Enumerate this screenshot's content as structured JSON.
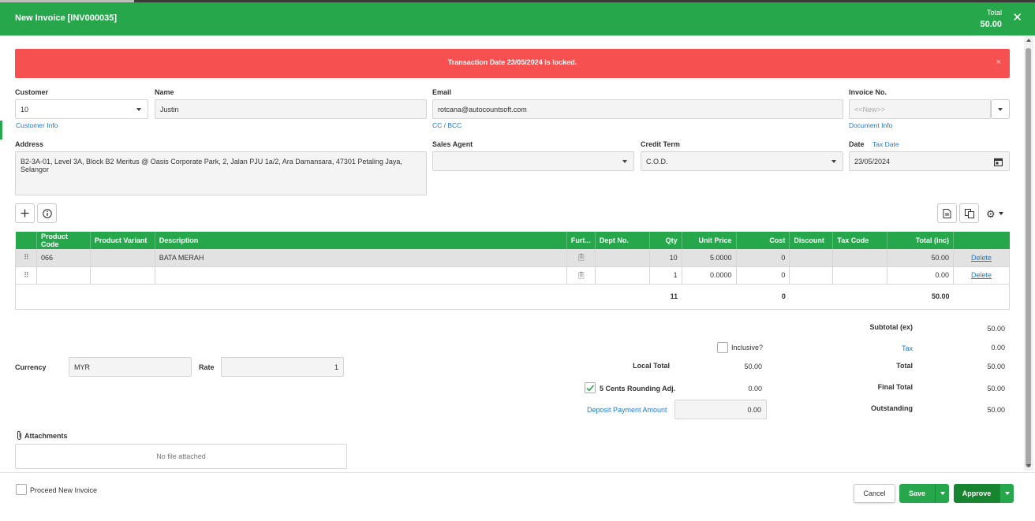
{
  "header": {
    "title": "New Invoice [INV000035]",
    "total_label": "Total",
    "total_value": "50.00",
    "close_icon": "close-icon"
  },
  "alert": {
    "message": "Transaction Date 23/05/2024 is locked.",
    "close": "×"
  },
  "customer": {
    "label": "Customer",
    "value": "10",
    "link": "Customer Info"
  },
  "name": {
    "label": "Name",
    "value": "Justin"
  },
  "email": {
    "label": "Email",
    "value": "rotcana@autocountsoft.com",
    "link": "CC / BCC"
  },
  "invoice_no": {
    "label": "Invoice No.",
    "placeholder": "<<New>>",
    "link": "Document Info"
  },
  "address": {
    "label": "Address",
    "value": "B2-3A-01, Level 3A, Block B2 Meritus @ Oasis Corporate Park, 2, Jalan PJU 1a/2, Ara Damansara, 47301 Petaling Jaya, Selangor"
  },
  "sales_agent": {
    "label": "Sales Agent",
    "value": ""
  },
  "credit_term": {
    "label": "Credit Term",
    "value": "C.O.D."
  },
  "date": {
    "label": "Date",
    "tax_date_link": "Tax Date",
    "value": "23/05/2024"
  },
  "grid": {
    "columns": [
      "Product Code",
      "Product Variant",
      "Description",
      "Furt...",
      "Dept No.",
      "Qty",
      "Unit Price",
      "Cost",
      "Discount",
      "Tax Code",
      "Total (inc)"
    ],
    "rows": [
      {
        "code": "066",
        "variant": "",
        "description": "BATA MERAH",
        "dept": "",
        "qty": "10",
        "unit_price": "5.0000",
        "cost": "0",
        "discount": "",
        "tax_code": "",
        "total": "50.00",
        "action": "Delete"
      },
      {
        "code": "",
        "variant": "",
        "description": "",
        "dept": "",
        "qty": "1",
        "unit_price": "0.0000",
        "cost": "0",
        "discount": "",
        "tax_code": "",
        "total": "0.00",
        "action": "Delete"
      }
    ],
    "totals": {
      "qty": "11",
      "cost": "0",
      "total": "50.00"
    }
  },
  "currency": {
    "label": "Currency",
    "value": "MYR",
    "rate_label": "Rate",
    "rate_value": "1"
  },
  "middle": {
    "inclusive_label": "Inclusive?",
    "local_total_label": "Local Total",
    "local_total_value": "50.00",
    "rounding_label": "5 Cents Rounding Adj.",
    "rounding_value": "0.00",
    "deposit_label": "Deposit Payment Amount",
    "deposit_value": "0.00"
  },
  "summary": {
    "subtotal_label": "Subtotal (ex)",
    "subtotal_value": "50.00",
    "tax_label": "Tax",
    "tax_value": "0.00",
    "total_label": "Total",
    "total_value": "50.00",
    "final_total_label": "Final Total",
    "final_total_value": "50.00",
    "outstanding_label": "Outstanding",
    "outstanding_value": "50.00"
  },
  "attachments": {
    "label": "Attachments",
    "empty": "No file attached"
  },
  "footer": {
    "proceed_label": "Proceed New Invoice",
    "cancel": "Cancel",
    "save": "Save",
    "approve": "Approve"
  },
  "colors": {
    "primary": "#27a74b",
    "alert": "#f75050",
    "approve": "#17842f",
    "link": "#1e7ad6"
  }
}
